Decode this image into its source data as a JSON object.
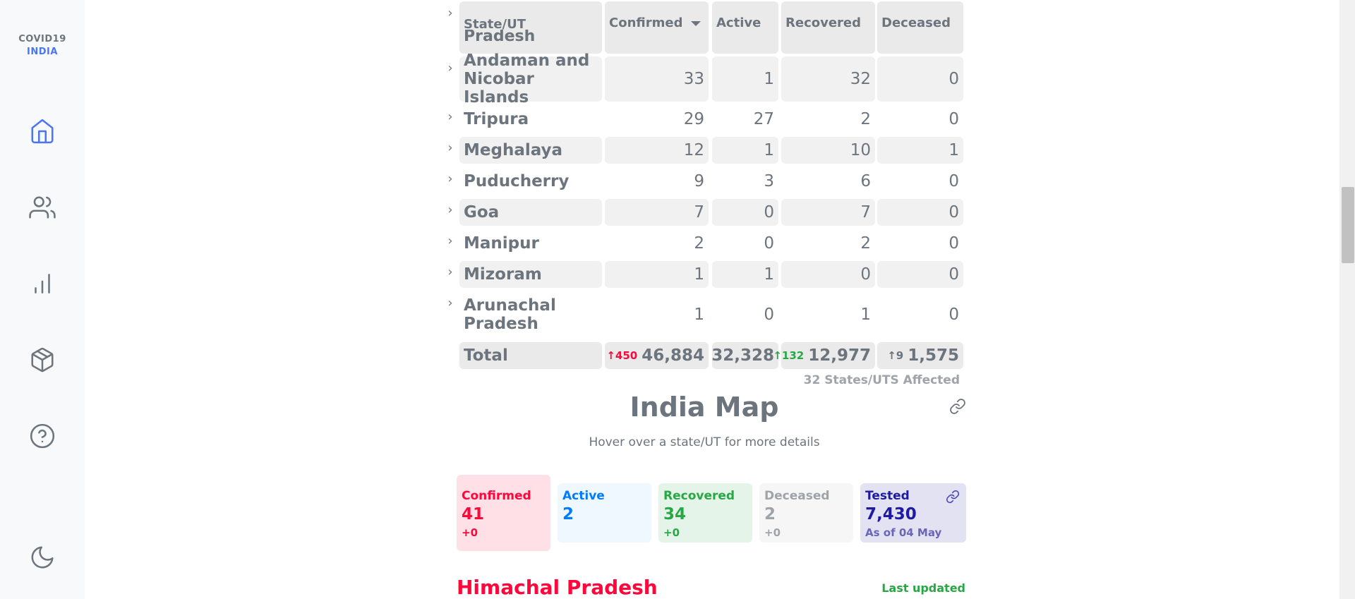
{
  "app": {
    "logo_line1": "COVID19",
    "logo_line2": "INDIA"
  },
  "nav": [
    "home-icon",
    "users-icon",
    "bar-chart-icon",
    "package-icon",
    "help-icon",
    "moon-icon"
  ],
  "table": {
    "headers": {
      "state": "State/UT",
      "confirmed": "Confirmed",
      "active": "Active",
      "recovered": "Recovered",
      "deceased": "Deceased"
    },
    "partial_row_text": "Pradesh",
    "rows": [
      {
        "state": "Andaman and Nicobar Islands",
        "confirmed": "33",
        "active": "1",
        "recovered": "32",
        "deceased": "0"
      },
      {
        "state": "Tripura",
        "confirmed": "29",
        "active": "27",
        "recovered": "2",
        "deceased": "0"
      },
      {
        "state": "Meghalaya",
        "confirmed": "12",
        "active": "1",
        "recovered": "10",
        "deceased": "1"
      },
      {
        "state": "Puducherry",
        "confirmed": "9",
        "active": "3",
        "recovered": "6",
        "deceased": "0"
      },
      {
        "state": "Goa",
        "confirmed": "7",
        "active": "0",
        "recovered": "7",
        "deceased": "0"
      },
      {
        "state": "Manipur",
        "confirmed": "2",
        "active": "0",
        "recovered": "2",
        "deceased": "0"
      },
      {
        "state": "Mizoram",
        "confirmed": "1",
        "active": "1",
        "recovered": "0",
        "deceased": "0"
      },
      {
        "state": "Arunachal Pradesh",
        "confirmed": "1",
        "active": "0",
        "recovered": "1",
        "deceased": "0"
      }
    ],
    "total": {
      "label": "Total",
      "confirmed": "46,884",
      "confirmed_delta": "↑450",
      "active": "32,328",
      "recovered": "12,977",
      "recovered_delta": "↑132",
      "deceased": "1,575",
      "deceased_delta": "↑9"
    },
    "affected": "32 States/UTS Affected"
  },
  "map": {
    "title": "India Map",
    "subtitle": "Hover over a state/UT for more details",
    "stats": {
      "confirmed": {
        "label": "Confirmed",
        "value": "41",
        "delta": "+0"
      },
      "active": {
        "label": "Active",
        "value": "2"
      },
      "recovered": {
        "label": "Recovered",
        "value": "34",
        "delta": "+0"
      },
      "deceased": {
        "label": "Deceased",
        "value": "2",
        "delta": "+0"
      },
      "tested": {
        "label": "Tested",
        "value": "7,430",
        "note": "As of 04 May"
      }
    },
    "selected_state": "Himachal Pradesh",
    "last_updated": "Last updated"
  },
  "colors": {
    "confirmed": "#ff073a",
    "active": "#007bff",
    "recovered": "#28a745",
    "deceased": "#6c757d",
    "tested": "#201aa2",
    "accent": "#4c75f2"
  }
}
